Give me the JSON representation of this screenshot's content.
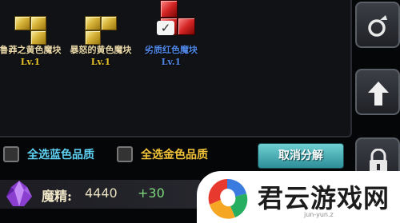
{
  "inventory": {
    "items": [
      {
        "name": "鲁莽之黄色魔块",
        "level": "Lv.1",
        "type": "gold",
        "selected": false
      },
      {
        "name": "暴怒的黄色魔块",
        "level": "Lv.1",
        "type": "gold",
        "selected": false
      },
      {
        "name": "劣质红色魔块",
        "level": "Lv.1",
        "type": "red",
        "selected": true
      }
    ]
  },
  "filters": {
    "select_blue_label": "全选蓝色品质",
    "select_gold_label": "全选金色品质"
  },
  "actions": {
    "cancel_label": "取消分解"
  },
  "resource": {
    "label": "魔精:",
    "value": "4440",
    "gain": "+30"
  },
  "sidebar": {
    "buttons": [
      "ring-icon",
      "up-arrow-icon",
      "lock-icon"
    ]
  },
  "watermark": {
    "text": "君云游戏网",
    "url": "jun-yun.z"
  },
  "colors": {
    "blue_text": "#5ed0f2",
    "gold_text": "#f3c43a",
    "cancel_button": "#3fa8b0",
    "gain_text": "#7dd87d"
  }
}
